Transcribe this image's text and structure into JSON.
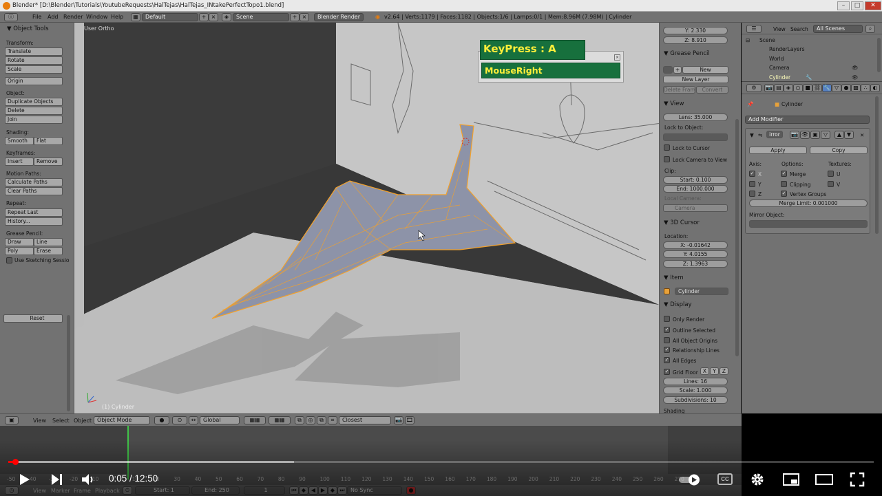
{
  "window": {
    "title": "Blender* [D:\\Blender\\Tutorials\\YoutubeRequests\\HalTejas\\HalTejas_INtakePerfectTopo1.blend]",
    "btn_min": "–",
    "btn_max": "□",
    "btn_close": "✕"
  },
  "infobar": {
    "menus": [
      "File",
      "Add",
      "Render",
      "Window",
      "Help"
    ],
    "layout": "Default",
    "scene": "Scene",
    "engine": "Blender Render",
    "stats": "v2.64 | Verts:1179 | Faces:1182 | Objects:1/6 | Lamps:0/1 | Mem:8.96M (7.98M) | Cylinder"
  },
  "toolshelf": {
    "title": "Object Tools",
    "transform_label": "Transform:",
    "translate": "Translate",
    "rotate": "Rotate",
    "scale": "Scale",
    "origin": "Origin",
    "object_label": "Object:",
    "duplicate": "Duplicate Objects",
    "delete": "Delete",
    "join": "Join",
    "shading_label": "Shading:",
    "smooth": "Smooth",
    "flat": "Flat",
    "keyframes_label": "Keyframes:",
    "insert": "Insert",
    "remove": "Remove",
    "motion_label": "Motion Paths:",
    "calc_paths": "Calculate Paths",
    "clear_paths": "Clear Paths",
    "repeat_label": "Repeat:",
    "repeat_last": "Repeat Last",
    "history": "History...",
    "gp_label": "Grease Pencil:",
    "draw": "Draw",
    "line": "Line",
    "poly": "Poly",
    "erase": "Erase",
    "sketching": "Use Sketching Sessio",
    "reset": "Reset"
  },
  "viewport": {
    "view_name": "User Ortho",
    "object_label": "(1) Cylinder"
  },
  "overlay": {
    "keypress": "KeyPress : A",
    "mouse": "MouseRight"
  },
  "npanel": {
    "y": "Y: 2.330",
    "z": "Z: 8.910",
    "grease_pencil": "Grease Pencil",
    "new": "New",
    "new_layer": "New Layer",
    "delete_frame": "Delete Frame",
    "convert": "Convert",
    "view": "View",
    "lens": "Lens: 35.000",
    "lock_to_object": "Lock to Object:",
    "lock_to_cursor": "Lock to Cursor",
    "lock_camera": "Lock Camera to View",
    "clip": "Clip:",
    "clip_start": "Start: 0.100",
    "clip_end": "End: 1000.000",
    "local_camera": "Local Camera:",
    "camera": "Camera",
    "cursor3d": "3D Cursor",
    "location": "Location:",
    "cx": "X: -0.01642",
    "cy": "Y: 4.0155",
    "cz": "Z: 1.3963",
    "item": "Item",
    "item_name": "Cylinder",
    "display": "Display",
    "only_render": "Only Render",
    "outline_selected": "Outline Selected",
    "all_origins": "All Object Origins",
    "relationship_lines": "Relationship Lines",
    "all_edges": "All Edges",
    "grid_floor": "Grid Floor",
    "gx": "X",
    "gy": "Y",
    "gz": "Z",
    "lines": "Lines: 16",
    "gscale": "Scale: 1.000",
    "subdivisions": "Subdivisions: 10",
    "shading": "Shading"
  },
  "outliner": {
    "view": "View",
    "search": "Search",
    "filter": "All Scenes",
    "items": [
      "Scene",
      "RenderLayers",
      "World",
      "Camera",
      "Cylinder"
    ]
  },
  "properties": {
    "breadcrumb": "Cylinder",
    "add_modifier": "Add Modifier",
    "modifier_name": "irror",
    "apply": "Apply",
    "copy": "Copy",
    "axis": "Axis:",
    "options": "Options:",
    "textures": "Textures:",
    "ax_x": "X",
    "ax_y": "Y",
    "ax_z": "Z",
    "merge": "Merge",
    "clipping": "Clipping",
    "vertex_groups": "Vertex Groups",
    "tex_u": "U",
    "tex_v": "V",
    "merge_limit": "Merge Limit: 0.001000",
    "mirror_object": "Mirror Object:"
  },
  "vpheader": {
    "view": "View",
    "select": "Select",
    "object": "Object",
    "mode": "Object Mode",
    "orientation": "Global",
    "snap": "Closest"
  },
  "timeline": {
    "ticks": [
      "-50",
      "-40",
      "-30",
      "-20",
      "-10",
      "0",
      "10",
      "20",
      "30",
      "40",
      "50",
      "60",
      "70",
      "80",
      "90",
      "100",
      "110",
      "120",
      "130",
      "140",
      "150",
      "160",
      "170",
      "180",
      "190",
      "200",
      "210",
      "220",
      "230",
      "240",
      "250",
      "260",
      "270"
    ],
    "view": "View",
    "marker": "Marker",
    "frame": "Frame",
    "playback": "Playback",
    "start": "Start: 1",
    "end": "End: 250",
    "current": "1",
    "sync": "No Sync"
  },
  "player": {
    "time": "0:05 / 12:50",
    "played_fraction": 0.0065,
    "buffered_fraction": 0.33,
    "cc": "CC"
  }
}
